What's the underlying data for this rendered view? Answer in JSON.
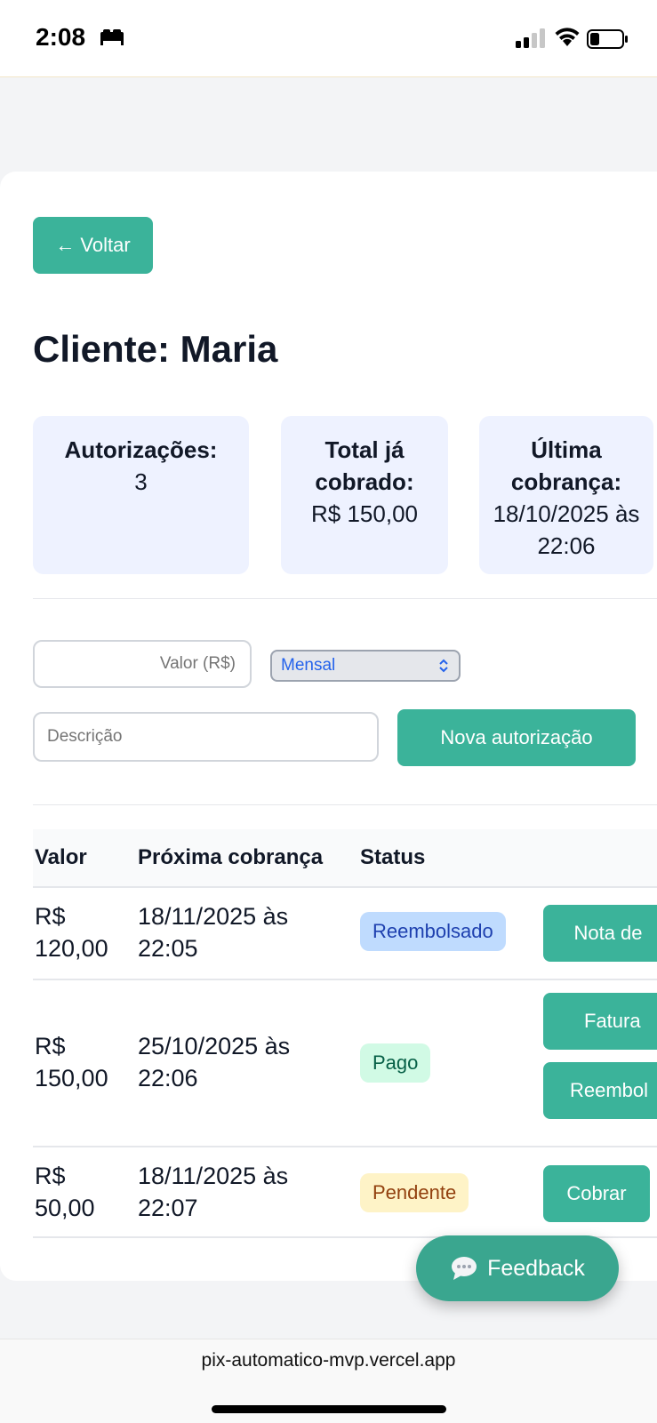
{
  "status_bar": {
    "time": "2:08"
  },
  "back_button": {
    "label": "← Voltar"
  },
  "page_title": "Cliente: Maria",
  "stats": [
    {
      "label": "Autorizações:",
      "value": "3"
    },
    {
      "label": "Total já cobrado:",
      "value": "R$ 150,00"
    },
    {
      "label": "Última cobrança:",
      "value": "18/10/2025 às 22:06"
    }
  ],
  "form": {
    "valor_placeholder": "Valor (R$)",
    "frequency_selected": "Mensal",
    "descricao_placeholder": "Descrição",
    "submit_label": "Nova autorização"
  },
  "table": {
    "headers": [
      "Valor",
      "Próxima cobrança",
      "Status"
    ],
    "rows": [
      {
        "valor": "R$ 120,00",
        "proxima": "18/11/2025 às 22:05",
        "status": "Reembolsado",
        "actions": [
          "Nota de"
        ]
      },
      {
        "valor": "R$ 150,00",
        "proxima": "25/10/2025 às 22:06",
        "status": "Pago",
        "actions": [
          "Fatura",
          "Reembol"
        ]
      },
      {
        "valor": "R$ 50,00",
        "proxima": "18/11/2025 às 22:07",
        "status": "Pendente",
        "actions": [
          "Cobrar"
        ]
      }
    ]
  },
  "feedback": {
    "label": "Feedback"
  },
  "browser": {
    "url": "pix-automatico-mvp.vercel.app"
  },
  "colors": {
    "accent": "#3bb39a",
    "card_bg": "#eef2ff"
  }
}
